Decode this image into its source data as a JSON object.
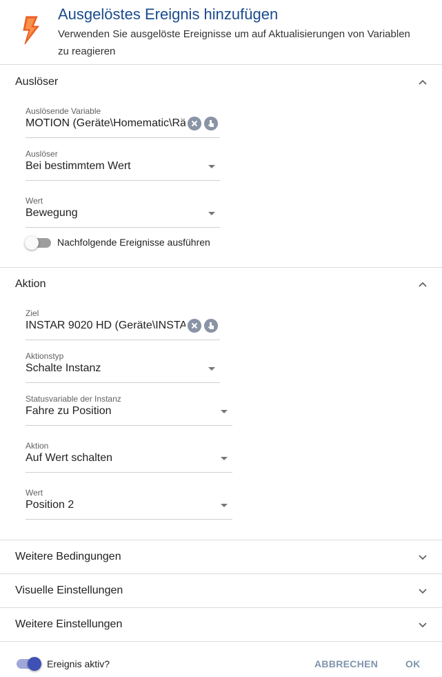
{
  "header": {
    "title": "Ausgelöstes Ereignis hinzufügen",
    "subtitle": "Verwenden Sie ausgelöste Ereignisse um auf Aktualisierungen von Variablen zu reagieren",
    "icon": "lightning-bolt-icon",
    "icon_color": "#f26a2b"
  },
  "trigger_section": {
    "title": "Auslöser",
    "expanded": true,
    "variable": {
      "label": "Auslösende Variable",
      "value": "MOTION (Geräte\\Homematic\\Rä"
    },
    "trigger": {
      "label": "Auslöser",
      "value": "Bei bestimmtem Wert"
    },
    "value": {
      "label": "Wert",
      "value": "Bewegung"
    },
    "subsequent_toggle": {
      "label": "Nachfolgende Ereignisse ausführen",
      "on": false
    }
  },
  "action_section": {
    "title": "Aktion",
    "expanded": true,
    "target": {
      "label": "Ziel",
      "value": "INSTAR 9020 HD (Geräte\\INSTAF"
    },
    "action_type": {
      "label": "Aktionstyp",
      "value": "Schalte Instanz"
    },
    "status_variable": {
      "label": "Statusvariable der Instanz",
      "value": "Fahre zu Position"
    },
    "action": {
      "label": "Aktion",
      "value": "Auf Wert schalten"
    },
    "value": {
      "label": "Wert",
      "value": "Position 2"
    }
  },
  "collapsed_sections": [
    {
      "title": "Weitere Bedingungen"
    },
    {
      "title": "Visuelle Einstellungen"
    },
    {
      "title": "Weitere Einstellungen"
    }
  ],
  "footer": {
    "active_toggle": {
      "label": "Ereignis aktiv?",
      "on": true
    },
    "cancel_label": "ABBRECHEN",
    "ok_label": "OK"
  },
  "colors": {
    "accent": "#3f51b5",
    "title": "#1a4b8c",
    "footer_button": "#7f93ad"
  }
}
